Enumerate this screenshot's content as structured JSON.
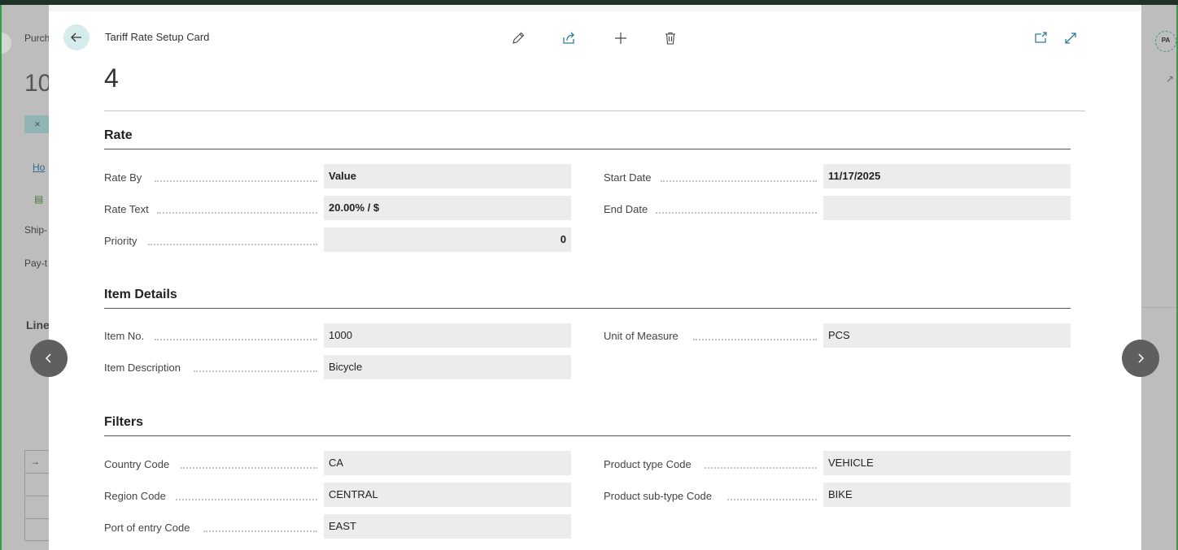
{
  "background": {
    "left_texts": [
      "Purch",
      "10",
      "×",
      "Ho",
      "Ship-",
      "Pay-t",
      "Line",
      "→"
    ],
    "right_badge": "PA"
  },
  "card": {
    "breadcrumb": "Tariff Rate Setup Card",
    "record_no": "4",
    "toolbar": {
      "edit_icon": "pencil-icon",
      "share_icon": "share-icon",
      "new_icon": "plus-icon",
      "delete_icon": "trash-icon",
      "open_new_window_icon": "open-new-window-icon",
      "expand_icon": "expand-icon"
    }
  },
  "sections": {
    "rate": {
      "title": "Rate",
      "rate_by_label": "Rate By",
      "rate_by_value": "Value",
      "rate_text_label": "Rate Text",
      "rate_text_value": "20.00% / $",
      "priority_label": "Priority",
      "priority_value": "0",
      "start_date_label": "Start Date",
      "start_date_value": "11/17/2025",
      "end_date_label": "End Date",
      "end_date_value": ""
    },
    "item_details": {
      "title": "Item Details",
      "item_no_label": "Item No.",
      "item_no_value": "1000",
      "item_description_label": "Item Description",
      "item_description_value": "Bicycle",
      "uom_label": "Unit of Measure",
      "uom_value": "PCS"
    },
    "filters": {
      "title": "Filters",
      "country_code_label": "Country Code",
      "country_code_value": "CA",
      "region_code_label": "Region Code",
      "region_code_value": "CENTRAL",
      "port_label": "Port of entry Code",
      "port_value": "EAST",
      "product_type_label": "Product type Code",
      "product_type_value": "VEHICLE",
      "product_subtype_label": "Product sub-type Code",
      "product_subtype_value": "BIKE"
    }
  },
  "colors": {
    "accent": "#1e3226",
    "back_button_bg": "#d6ecec",
    "field_bg": "#ececec",
    "nav_circle": "#5e6060"
  }
}
